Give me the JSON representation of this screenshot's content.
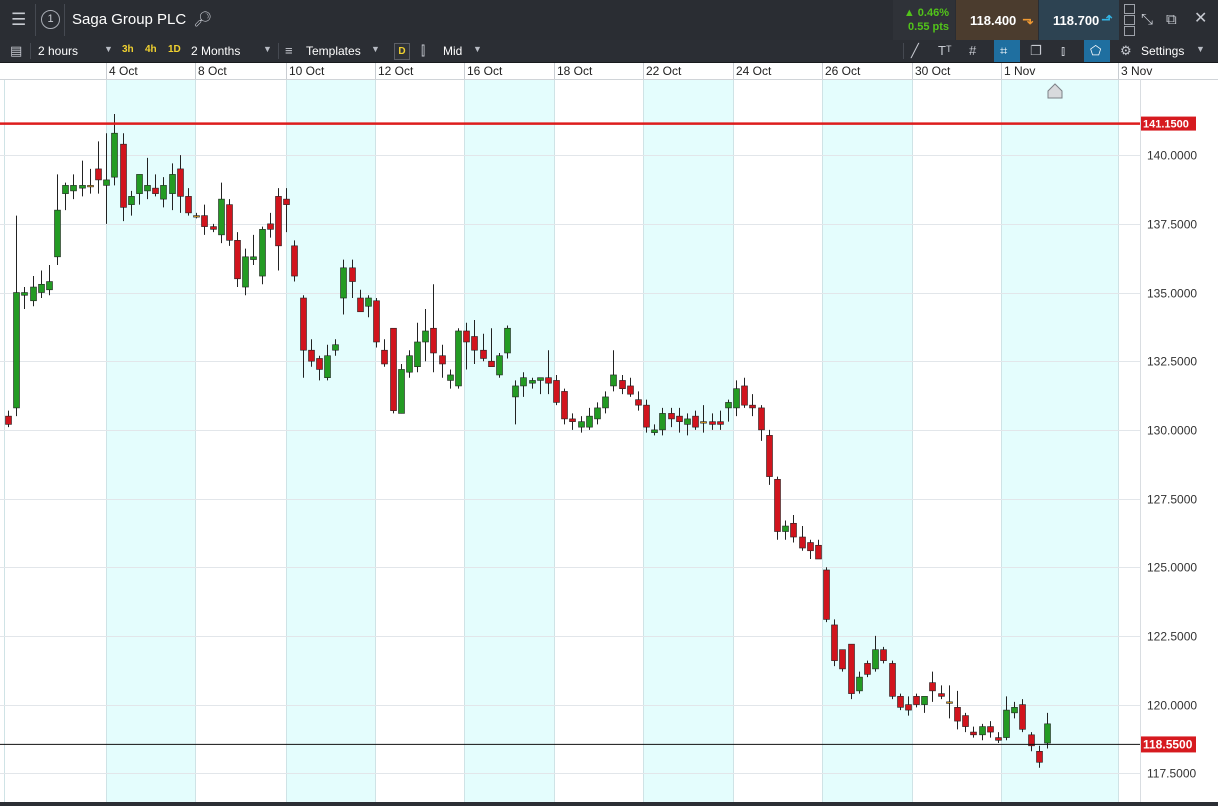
{
  "header": {
    "title": "Saga Group PLC",
    "panel_number": "1",
    "change_percent": "0.46%",
    "change_points": "0.55 pts",
    "sell_price": "118.400",
    "buy_price": "118.700"
  },
  "toolbar": {
    "interval": "2 hours",
    "quick_intervals": [
      "3h",
      "4h",
      "1D"
    ],
    "range": "2 Months",
    "templates_label": "Templates",
    "daily_badge": "D",
    "price_type": "Mid",
    "settings_label": "Settings"
  },
  "colors": {
    "up": "#239b23",
    "down": "#d1141d",
    "price_line": "#dd1d1d",
    "band": "#e4fdfd",
    "accent": "#1f6fa0"
  },
  "icons": [
    "menu-icon",
    "search-icon",
    "caret-down-icon",
    "grid-icon",
    "draw-line-icon",
    "text-icon",
    "crosshair-icon",
    "copy-icon",
    "indicator-icon",
    "tag-icon",
    "gear-icon",
    "minimize-icon",
    "popout-icon",
    "close-icon"
  ],
  "chart_data": {
    "type": "candlestick",
    "x_labels": [
      "4 Oct",
      "8 Oct",
      "10 Oct",
      "12 Oct",
      "16 Oct",
      "18 Oct",
      "22 Oct",
      "24 Oct",
      "26 Oct",
      "30 Oct",
      "1 Nov",
      "3 Nov"
    ],
    "y_ticks": [
      "140.0000",
      "137.5000",
      "135.0000",
      "132.5000",
      "130.0000",
      "127.5000",
      "125.0000",
      "122.5000",
      "120.0000",
      "117.5000"
    ],
    "ylim": [
      116.6,
      142.7
    ],
    "reference_line": {
      "value": 141.15,
      "label": "141.1500"
    },
    "current_line": {
      "value": 118.55,
      "label": "118.5500"
    },
    "candles": [
      [
        130.5,
        130.7,
        130.1,
        130.2
      ],
      [
        130.8,
        137.8,
        130.5,
        135.0
      ],
      [
        134.9,
        135.2,
        134.4,
        135.0
      ],
      [
        134.7,
        135.6,
        134.5,
        135.2
      ],
      [
        135.0,
        135.8,
        134.8,
        135.3
      ],
      [
        135.1,
        136.0,
        134.9,
        135.4
      ],
      [
        136.3,
        139.3,
        136.0,
        138.0
      ],
      [
        138.6,
        139.0,
        138.0,
        138.9
      ],
      [
        138.7,
        139.3,
        138.4,
        138.9
      ],
      [
        138.8,
        139.8,
        138.5,
        138.9
      ],
      [
        138.9,
        139.5,
        138.6,
        138.9
      ],
      [
        139.5,
        140.5,
        138.6,
        139.1
      ],
      [
        138.9,
        140.8,
        137.5,
        139.1
      ],
      [
        139.2,
        141.5,
        138.9,
        140.8
      ],
      [
        140.4,
        140.8,
        137.6,
        138.1
      ],
      [
        138.2,
        138.7,
        137.8,
        138.5
      ],
      [
        138.6,
        139.2,
        138.2,
        139.3
      ],
      [
        138.7,
        139.9,
        138.4,
        138.9
      ],
      [
        138.8,
        139.3,
        138.5,
        138.6
      ],
      [
        138.4,
        139.2,
        138.1,
        138.9
      ],
      [
        138.6,
        139.7,
        138.0,
        139.3
      ],
      [
        139.5,
        140.0,
        137.9,
        138.5
      ],
      [
        138.5,
        138.8,
        137.8,
        137.9
      ],
      [
        137.8,
        137.9,
        137.7,
        137.8
      ],
      [
        137.8,
        138.2,
        137.1,
        137.4
      ],
      [
        137.4,
        137.5,
        137.2,
        137.3
      ],
      [
        137.1,
        139.0,
        136.8,
        138.4
      ],
      [
        138.2,
        138.4,
        136.7,
        136.9
      ],
      [
        136.9,
        137.2,
        135.2,
        135.5
      ],
      [
        135.2,
        136.6,
        134.9,
        136.3
      ],
      [
        136.2,
        137.1,
        136.0,
        136.3
      ],
      [
        135.6,
        137.4,
        135.3,
        137.3
      ],
      [
        137.5,
        137.9,
        137.0,
        137.3
      ],
      [
        138.5,
        138.8,
        135.8,
        136.7
      ],
      [
        138.4,
        138.8,
        137.2,
        138.2
      ],
      [
        136.7,
        136.9,
        135.4,
        135.6
      ],
      [
        134.8,
        134.9,
        131.9,
        132.9
      ],
      [
        132.9,
        133.3,
        132.3,
        132.5
      ],
      [
        132.6,
        132.7,
        131.8,
        132.2
      ],
      [
        131.9,
        133.1,
        131.8,
        132.7
      ],
      [
        132.9,
        133.3,
        132.7,
        133.1
      ],
      [
        134.8,
        136.2,
        134.2,
        135.9
      ],
      [
        135.9,
        136.2,
        134.8,
        135.4
      ],
      [
        134.8,
        135.1,
        134.3,
        134.3
      ],
      [
        134.5,
        134.9,
        134.1,
        134.8
      ],
      [
        134.7,
        134.8,
        133.0,
        133.2
      ],
      [
        132.9,
        133.3,
        132.3,
        132.4
      ],
      [
        133.7,
        133.7,
        130.6,
        130.7
      ],
      [
        130.6,
        132.4,
        130.6,
        132.2
      ],
      [
        132.1,
        132.9,
        131.9,
        132.7
      ],
      [
        132.3,
        133.9,
        132.1,
        133.2
      ],
      [
        133.2,
        134.4,
        132.5,
        133.6
      ],
      [
        133.7,
        135.3,
        132.1,
        132.8
      ],
      [
        132.7,
        133.1,
        131.9,
        132.4
      ],
      [
        131.8,
        132.2,
        131.5,
        132.0
      ],
      [
        131.6,
        133.7,
        131.5,
        133.6
      ],
      [
        133.6,
        133.9,
        132.2,
        133.2
      ],
      [
        133.4,
        134.0,
        132.4,
        132.9
      ],
      [
        132.9,
        133.5,
        132.5,
        132.6
      ],
      [
        132.5,
        133.7,
        132.3,
        132.3
      ],
      [
        132.0,
        132.8,
        131.9,
        132.7
      ],
      [
        132.8,
        133.8,
        132.6,
        133.7
      ],
      [
        131.2,
        131.8,
        130.2,
        131.6
      ],
      [
        131.6,
        132.1,
        131.2,
        131.9
      ],
      [
        131.7,
        131.9,
        131.5,
        131.8
      ],
      [
        131.8,
        131.9,
        131.3,
        131.9
      ],
      [
        131.9,
        132.9,
        131.3,
        131.7
      ],
      [
        131.8,
        132.0,
        130.9,
        131.0
      ],
      [
        131.4,
        131.5,
        130.2,
        130.4
      ],
      [
        130.4,
        130.6,
        130.0,
        130.3
      ],
      [
        130.1,
        130.5,
        129.9,
        130.3
      ],
      [
        130.1,
        130.8,
        130.0,
        130.5
      ],
      [
        130.4,
        131.0,
        130.2,
        130.8
      ],
      [
        130.8,
        131.4,
        130.6,
        131.2
      ],
      [
        131.6,
        132.9,
        131.4,
        132.0
      ],
      [
        131.8,
        132.0,
        131.3,
        131.5
      ],
      [
        131.6,
        131.9,
        131.2,
        131.3
      ],
      [
        131.1,
        131.4,
        130.7,
        130.9
      ],
      [
        130.9,
        131.1,
        129.9,
        130.1
      ],
      [
        129.9,
        130.2,
        129.8,
        130.0
      ],
      [
        130.0,
        130.8,
        129.8,
        130.6
      ],
      [
        130.6,
        130.8,
        130.1,
        130.4
      ],
      [
        130.5,
        130.8,
        129.9,
        130.3
      ],
      [
        130.2,
        130.6,
        129.8,
        130.4
      ],
      [
        130.5,
        130.7,
        130.0,
        130.1
      ],
      [
        130.3,
        130.9,
        129.9,
        130.3
      ],
      [
        130.3,
        130.6,
        130.0,
        130.2
      ],
      [
        130.3,
        130.7,
        130.0,
        130.2
      ],
      [
        130.8,
        131.1,
        130.3,
        131.0
      ],
      [
        130.8,
        131.8,
        130.5,
        131.5
      ],
      [
        131.6,
        131.9,
        130.8,
        130.9
      ],
      [
        130.9,
        131.3,
        130.5,
        130.8
      ],
      [
        130.8,
        130.9,
        129.6,
        130.0
      ],
      [
        129.8,
        130.0,
        128.0,
        128.3
      ],
      [
        128.2,
        128.3,
        126.0,
        126.3
      ],
      [
        126.3,
        126.7,
        126.0,
        126.5
      ],
      [
        126.6,
        126.9,
        125.9,
        126.1
      ],
      [
        126.1,
        126.5,
        125.6,
        125.7
      ],
      [
        125.9,
        126.0,
        125.3,
        125.6
      ],
      [
        125.8,
        126.0,
        125.3,
        125.3
      ],
      [
        124.9,
        125.0,
        123.0,
        123.1
      ],
      [
        122.9,
        123.1,
        121.4,
        121.6
      ],
      [
        122.0,
        122.0,
        121.2,
        121.3
      ],
      [
        122.2,
        122.2,
        120.2,
        120.4
      ],
      [
        120.5,
        121.2,
        120.4,
        121.0
      ],
      [
        121.5,
        121.6,
        121.0,
        121.1
      ],
      [
        121.3,
        122.5,
        121.2,
        122.0
      ],
      [
        122.0,
        122.1,
        121.5,
        121.6
      ],
      [
        121.5,
        121.6,
        120.2,
        120.3
      ],
      [
        120.3,
        120.4,
        119.8,
        119.9
      ],
      [
        120.0,
        120.3,
        119.6,
        119.8
      ],
      [
        120.3,
        120.4,
        119.9,
        120.0
      ],
      [
        120.0,
        120.2,
        119.7,
        120.3
      ],
      [
        120.8,
        121.2,
        120.1,
        120.5
      ],
      [
        120.4,
        120.7,
        120.2,
        120.3
      ],
      [
        120.1,
        120.7,
        119.5,
        120.1
      ],
      [
        119.9,
        120.5,
        119.1,
        119.4
      ],
      [
        119.6,
        119.7,
        119.0,
        119.2
      ],
      [
        119.0,
        119.2,
        118.8,
        118.9
      ],
      [
        118.9,
        119.3,
        118.7,
        119.2
      ],
      [
        119.2,
        119.4,
        118.8,
        119.0
      ],
      [
        118.8,
        119.0,
        118.6,
        118.7
      ],
      [
        118.8,
        120.3,
        118.7,
        119.8
      ],
      [
        119.7,
        120.1,
        119.5,
        119.9
      ],
      [
        120.0,
        120.2,
        119.0,
        119.1
      ],
      [
        118.9,
        119.0,
        118.3,
        118.5
      ],
      [
        118.3,
        118.5,
        117.7,
        117.9
      ],
      [
        118.6,
        119.7,
        118.4,
        119.3
      ]
    ]
  }
}
